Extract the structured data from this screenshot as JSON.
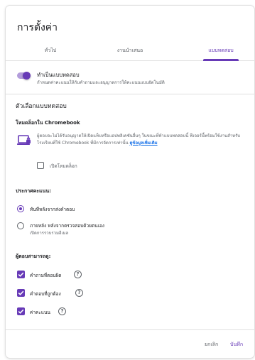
{
  "dialog": {
    "title": "การตั้งค่า"
  },
  "tabs": [
    {
      "label": "ทั่วไป",
      "active": false
    },
    {
      "label": "งานนำเสนอ",
      "active": false
    },
    {
      "label": "แบบทดสอบ",
      "active": true
    }
  ],
  "quiz_toggle": {
    "title": "ทำเป็นแบบทดสอบ",
    "subtitle": "กำหนดค่าคะแนนให้กับคำถามและอนุญาตการให้คะแนนแบบอัตโนมัติ",
    "enabled": true
  },
  "quiz_options": {
    "heading": "ตัวเลือกแบบทดสอบ",
    "locked_mode": {
      "heading": "โหมดล็อกใน Chromebook",
      "description": "ผู้ตอบจะไม่ได้รับอนุญาตให้เปิดแท็บหรือแอปพลิเคชันอื่นๆ ในขณะที่ทำแบบทดสอบนี้ ฟีเจอร์นี้พร้อมใช้งานสำหรับโรงเรียนที่ใช้ Chromebook ที่มีการจัดการเท่านั้น",
      "learn_more": "ดูข้อมูลเพิ่มเติม",
      "checkbox_label": "เปิดโหมดล็อก",
      "checked": false,
      "icon": "locked-laptop-icon"
    }
  },
  "release_grade": {
    "heading": "ประกาศคะแนน:",
    "options": [
      {
        "label": "ทันทีหลังจากส่งคำตอบ",
        "sublabel": "",
        "selected": true
      },
      {
        "label": "ภายหลัง หลังจากตรวจสอบด้วยตนเอง",
        "sublabel": "เปิดการรวบรวมอีเมล",
        "selected": false
      }
    ]
  },
  "respondent_can_see": {
    "heading": "ผู้ตอบสามารถดู:",
    "options": [
      {
        "label": "คำถามที่ตอบผิด",
        "checked": true,
        "help": "?"
      },
      {
        "label": "คำตอบที่ถูกต้อง",
        "checked": true,
        "help": "?"
      },
      {
        "label": "ค่าคะแนน",
        "checked": true,
        "help": "?"
      }
    ]
  },
  "footer": {
    "cancel_label": "ยกเลิก",
    "save_label": "บันทึก"
  },
  "colors": {
    "accent": "#673ab7",
    "accent_light": "#b39ddb",
    "link": "#1a73e8",
    "secondary_text": "#5f6368"
  }
}
